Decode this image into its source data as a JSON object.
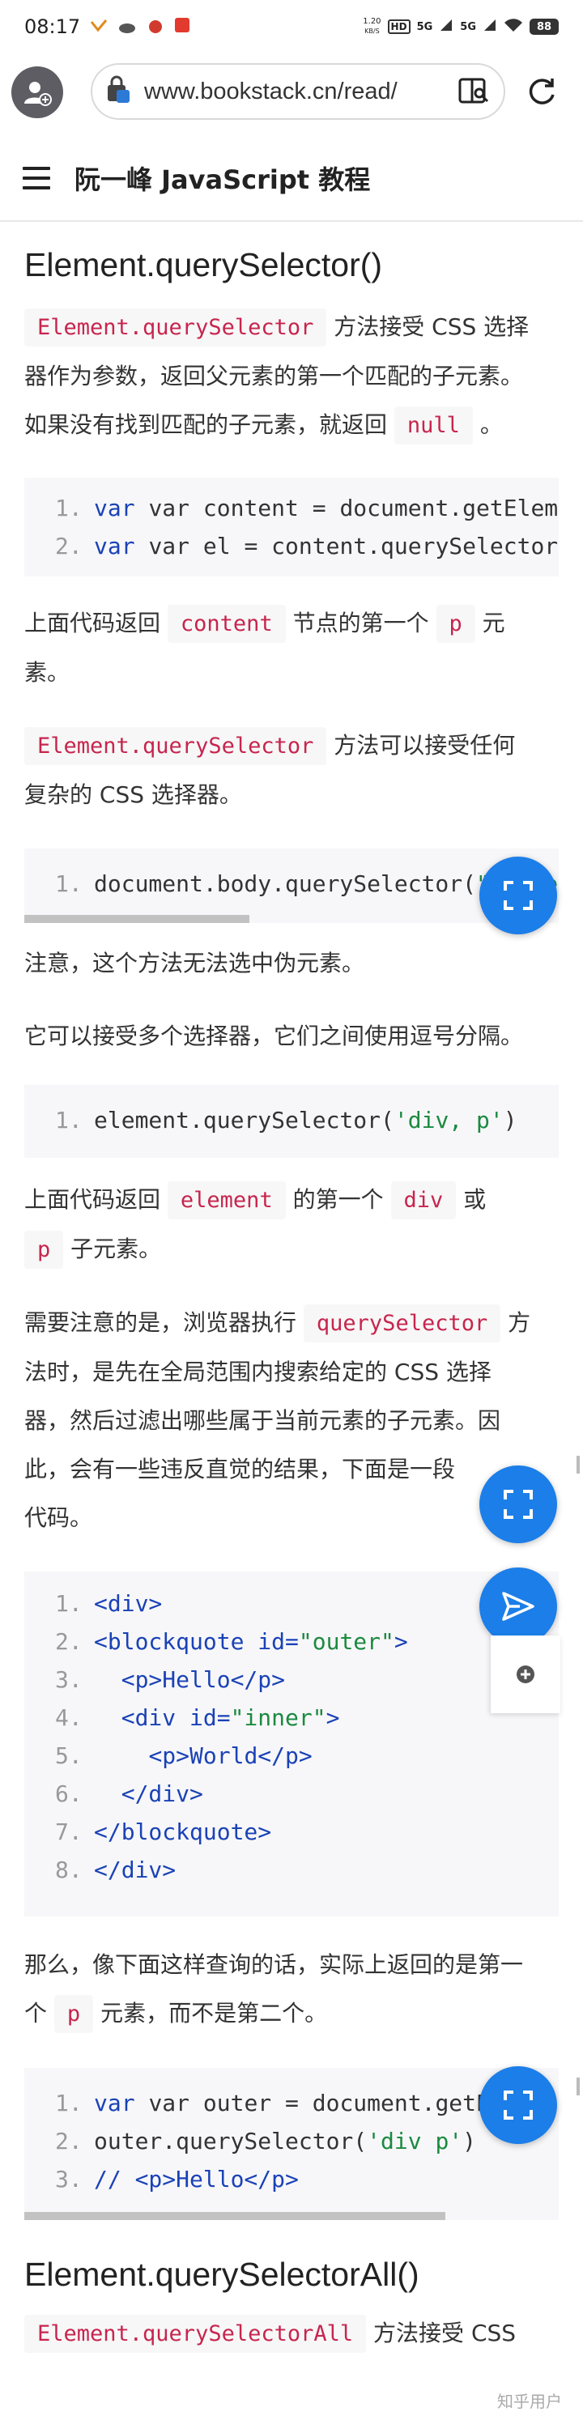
{
  "status": {
    "time": "08:17",
    "speed": "1.20",
    "speed_unit": "KB/S",
    "hd": "HD",
    "signal1": "5G",
    "signal2": "5G",
    "battery": "88"
  },
  "browser": {
    "url": "www.bookstack.cn/read/"
  },
  "book": {
    "title": "阮一峰 JavaScript 教程"
  },
  "section1": {
    "heading": "Element.querySelector()",
    "p1": {
      "code": "Element.querySelector",
      "line1": " 方法接受 CSS 选择",
      "line2": "器作为参数，返回父元素的第一个匹配的子元素。",
      "line3a": "如果没有找到匹配的子元素，就返回 ",
      "code2": "null",
      "line3b": " 。"
    },
    "code1": [
      "var content = document.getElementB",
      "var el = content.querySelector('p'"
    ],
    "p2": {
      "a": "上面代码返回 ",
      "code1": "content",
      "b": " 节点的第一个 ",
      "code2": "p",
      "c": " 元",
      "d": "素。"
    },
    "p3": {
      "code": "Element.querySelector",
      "a": " 方法可以接受任何",
      "b": "复杂的 CSS 选择器。"
    },
    "code2": "document.body.querySelector(\"style",
    "p4": "注意，这个方法无法选中伪元素。",
    "p5": "它可以接受多个选择器，它们之间使用逗号分隔。",
    "code3": "element.querySelector('div, p')",
    "p6": {
      "a": "上面代码返回 ",
      "code1": "element",
      "b": " 的第一个 ",
      "code2": "div",
      "c": " 或",
      "code3": "p",
      "d": " 子元素。"
    },
    "p7": {
      "a": "需要注意的是，浏览器执行 ",
      "code": "querySelector",
      "b": " 方",
      "c": "法时，是先在全局范围内搜索给定的 CSS 选择",
      "d": "器，然后过滤出哪些属于当前元素的子元素。因",
      "e": "此，会有一些违反直觉的结果，下面是一段",
      "f": "代码。"
    },
    "code4": [
      "<div>",
      "<blockquote id=\"outer\">",
      "<p>Hello</p>",
      "<div id=\"inner\">",
      "<p>World</p>",
      "</div>",
      "</blockquote>",
      "</div>"
    ],
    "p8": {
      "a": "那么，像下面这样查询的话，实际上返回的是第一",
      "b": "个 ",
      "code": "p",
      "c": " 元素，而不是第二个。"
    },
    "code5": [
      "var outer = document.getElemen",
      "outer.querySelector('div p')",
      "// <p>Hello</p>"
    ]
  },
  "section2": {
    "heading": "Element.querySelectorAll()",
    "code": "Element.querySelectorAll",
    "text": " 方法接受 CSS"
  },
  "watermark": "知乎用户",
  "colors": {
    "accent": "#1c7ee8",
    "code_text": "#c7254e",
    "code_bg": "#f7f7f9"
  }
}
